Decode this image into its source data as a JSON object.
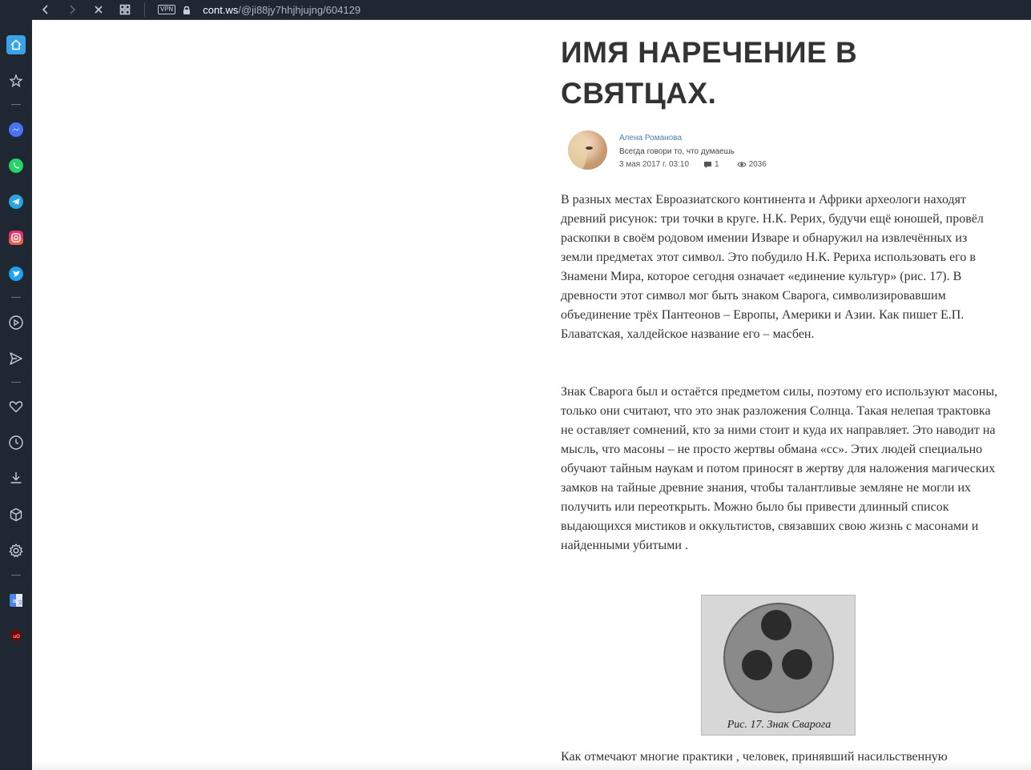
{
  "browser": {
    "url_host": "cont.ws",
    "url_path": "/@ji88jy7hhjhjujng/604129",
    "vpn_label": "VPN"
  },
  "sidebar": {
    "items": [
      {
        "name": "home",
        "color": "#3aa3e6"
      },
      {
        "name": "bookmarks"
      },
      {
        "name": "messenger",
        "color": "#1e88f5"
      },
      {
        "name": "whatsapp",
        "color": "#25d366"
      },
      {
        "name": "telegram",
        "color": "#2aa3df"
      },
      {
        "name": "instagram",
        "color": "#e1306c"
      },
      {
        "name": "twitter",
        "color": "#1da1f2"
      },
      {
        "name": "player"
      },
      {
        "name": "send"
      },
      {
        "name": "favorites"
      },
      {
        "name": "history"
      },
      {
        "name": "downloads"
      },
      {
        "name": "extensions"
      },
      {
        "name": "settings"
      },
      {
        "name": "translate",
        "color": "#4a86e8"
      },
      {
        "name": "ublock",
        "color": "#800000"
      }
    ]
  },
  "article": {
    "title": "ИМЯ НАРЕЧЕНИЕ В СВЯТЦАХ.",
    "author": {
      "name": "Алена Романова",
      "tagline": "Всегда говори то, что думаешь",
      "date": "3 мая 2017 г. 03:10",
      "comments": "1",
      "views": "2036"
    },
    "paragraphs": [
      "В разных местах Евроазиатского континента и Африки археологи находят древний рисунок: три точки в круге. Н.К. Рерих, будучи ещё юношей, провёл раскопки в своём родовом имении Изваре и обнаружил на извлечённых из земли предметах этот символ. Это побудило Н.К. Рериха использовать его в Знамени Мира, которое сегодня означает «единение культур» (рис. 17). В древности этот символ мог быть знаком Сварога, символизировавшим объединение трёх Пантеонов – Европы, Америки и Азии. Как пишет Е.П. Блаватская, халдейское название его – масбен.",
      "Знак Сварога был и остаётся предметом силы, поэтому его используют масоны, только они считают, что это знак разложения Солнца. Такая нелепая трактовка не оставляет сомнений, кто за ними стоит и куда их направляет. Это наводит на мысль, что масоны – не просто жертвы обмана «сс». Этих людей специально обучают тайным наукам и потом приносят в жертву для наложения магических замков на тайные древние знания, чтобы талантливые земляне не могли их получить или переоткрыть. Можно было бы привести длинный список выдающихся мистиков и оккультистов, связавших свою жизнь с масонами и найденными убитыми .",
      "Как отмечают многие практики , человек, принявший насильственную"
    ],
    "figure_caption": "Рис. 17. Знак Сварога"
  }
}
